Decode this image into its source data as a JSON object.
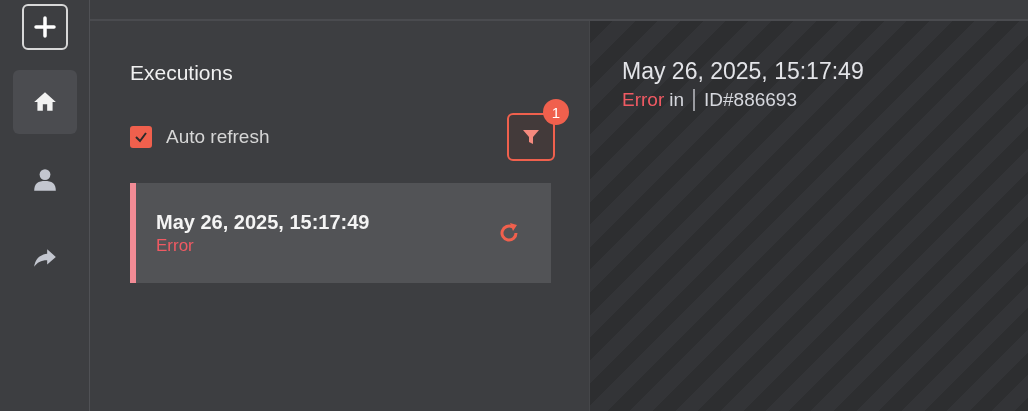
{
  "sidebar": {
    "items": [
      {
        "kind": "home",
        "selected": true
      },
      {
        "kind": "user",
        "selected": false
      },
      {
        "kind": "share",
        "selected": false
      }
    ]
  },
  "executions": {
    "title": "Executions",
    "auto_refresh": {
      "label": "Auto refresh",
      "checked": true
    },
    "filter": {
      "badge": "1"
    },
    "list": [
      {
        "time": "May 26, 2025, 15:17:49",
        "status": "Error",
        "selected": true
      }
    ]
  },
  "detail": {
    "time": "May 26, 2025, 15:17:49",
    "status": "Error",
    "context": "in",
    "id": "ID#886693"
  }
}
